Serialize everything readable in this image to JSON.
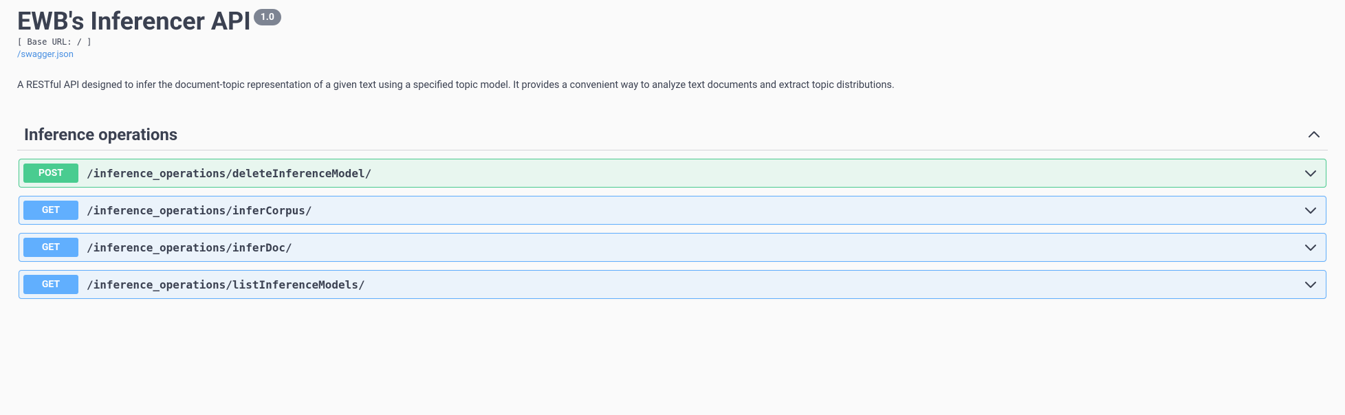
{
  "header": {
    "title": "EWB's Inferencer API",
    "version": "1.0",
    "base_url_label": "[ Base URL: / ]",
    "swagger_link": "/swagger.json",
    "description": "A RESTful API designed to infer the document-topic representation of a given text using a specified topic model. It provides a convenient way to analyze text documents and extract topic distributions."
  },
  "section": {
    "title": "Inference operations",
    "expanded": true,
    "operations": [
      {
        "method": "POST",
        "path": "/inference_operations/deleteInferenceModel/"
      },
      {
        "method": "GET",
        "path": "/inference_operations/inferCorpus/"
      },
      {
        "method": "GET",
        "path": "/inference_operations/inferDoc/"
      },
      {
        "method": "GET",
        "path": "/inference_operations/listInferenceModels/"
      }
    ]
  }
}
